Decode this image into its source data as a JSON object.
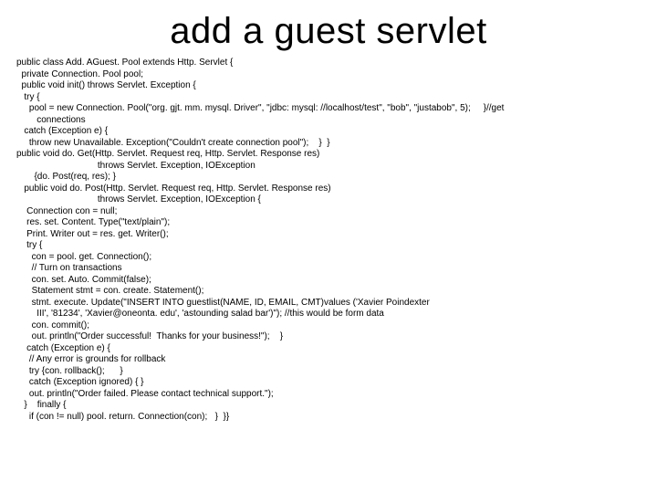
{
  "title": "add a guest servlet",
  "code_lines": [
    "public class Add. AGuest. Pool extends Http. Servlet {",
    "  private Connection. Pool pool;",
    "  public void init() throws Servlet. Exception {",
    "   try {",
    "     pool = new Connection. Pool(\"org. gjt. mm. mysql. Driver\", \"jdbc: mysql: //localhost/test\", \"bob\", \"justabob\", 5);     }//get",
    "        connections",
    "   catch (Exception e) {",
    "     throw new Unavailable. Exception(\"Couldn't create connection pool\");    }  }",
    "public void do. Get(Http. Servlet. Request req, Http. Servlet. Response res)",
    "                                throws Servlet. Exception, IOException",
    "       {do. Post(req, res); }",
    "   public void do. Post(Http. Servlet. Request req, Http. Servlet. Response res)",
    "                                throws Servlet. Exception, IOException {",
    "    Connection con = null;",
    "    res. set. Content. Type(\"text/plain\");",
    "    Print. Writer out = res. get. Writer();",
    "    try {",
    "      con = pool. get. Connection();",
    "      // Turn on transactions",
    "      con. set. Auto. Commit(false);",
    "      Statement stmt = con. create. Statement();",
    "      stmt. execute. Update(\"INSERT INTO guestlist(NAME, ID, EMAIL, CMT)values ('Xavier Poindexter",
    "        III', '81234', 'Xavier@oneonta. edu', 'astounding salad bar')\"); //this would be form data",
    "      con. commit();",
    "      out. println(\"Order successful!  Thanks for your business!\");    }",
    "    catch (Exception e) {",
    "     // Any error is grounds for rollback",
    "     try {con. rollback();      }",
    "     catch (Exception ignored) { }",
    "     out. println(\"Order failed. Please contact technical support.\");",
    "   }    finally {",
    "     if (con != null) pool. return. Connection(con);   }  }}"
  ]
}
